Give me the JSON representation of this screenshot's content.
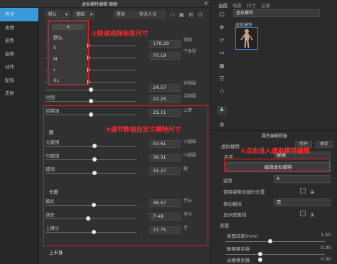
{
  "dialog": {
    "title": "虚拟模特编辑 娜娜",
    "close": "×"
  },
  "nav": {
    "items": [
      "尺寸",
      "表情",
      "姿势",
      "姿势",
      "动作",
      "配饰",
      "皮肤"
    ]
  },
  "toolbar": {
    "preset": "默认",
    "basic": "基础",
    "unit": "厘米",
    "search_placeholder": "你点人台"
  },
  "dropdown": {
    "add": "+",
    "items": [
      "默认",
      "S",
      "M",
      "L",
      "XL"
    ]
  },
  "rows": [
    {
      "label": "",
      "value": "178.29",
      "knob": 0.46
    },
    {
      "label": "",
      "value": "70.19",
      "knob": 0.46
    },
    {
      "label": "",
      "value": "",
      "knob": 0.46
    },
    {
      "label": "",
      "value": "",
      "knob": 0.46
    },
    {
      "label": "",
      "value": "24.57",
      "knob": 0.5
    },
    {
      "label": "时围",
      "value": "22.25",
      "knob": 0.5
    },
    {
      "label": "前臂围",
      "value": "21.11",
      "knob": 0.5
    },
    {
      "label": "大腿围",
      "value": "50.61",
      "knob": 0.54
    },
    {
      "label": "中腿围",
      "value": "36.31",
      "knob": 0.54
    },
    {
      "label": "膝围",
      "value": "31.27",
      "knob": 0.54
    },
    {
      "label": "胸长",
      "value": "38.57",
      "knob": 0.53
    },
    {
      "label": "颈长",
      "value": "7.48",
      "knob": 0.47
    },
    {
      "label": "上臂长",
      "value": "27.75",
      "knob": 0.53
    }
  ],
  "sections": {
    "leg": "腿",
    "length": "长度",
    "upper": "上半身"
  },
  "right_col": [
    "领部",
    "下身型",
    "手腕围",
    "手腕围",
    "上臂",
    "小腿围",
    "小腿围",
    "腿",
    "手长",
    "手长",
    "手"
  ],
  "annotations": {
    "a1": "①点击进入虚拟模特编辑",
    "a2": "②快速选择标准尺寸",
    "a3": "③调节数值自定义模特尺寸"
  },
  "right_top": {
    "tabs": [
      "当前",
      "场景",
      "尺寸",
      "记录"
    ],
    "search_value": "虚拟模特",
    "caption": "虚拟模特",
    "icons": [
      "person-icon",
      "move-icon",
      "rotate-icon",
      "arrow-icon",
      "grid-icon",
      "list-icon",
      "people-icon",
      "person-icon",
      "globe-icon"
    ]
  },
  "props": {
    "title": "属性编辑视窗",
    "open_label": "打开",
    "save_label": "保存",
    "section_label": "虚拟模特",
    "name_label": "名字",
    "name_value": "娜娜",
    "edit_button": "编辑虚拟模特",
    "pose_label": "姿势",
    "pose_value": "A",
    "use_pose_label": "使用姿势创建时位置",
    "use_pose_state": "关",
    "param_label": "参加模拟",
    "param_value": "是",
    "show_mesh_label": "显示图案线",
    "show_mesh_state": "关",
    "surface_label": "表面",
    "surface_thickness_label": "表面间距(mm)",
    "surface_thickness_value": "1.50",
    "friction_label": "静摩擦系数",
    "friction_value": "0.30",
    "dyn_friction_label": "动摩擦系数",
    "dyn_friction_value": "0.30",
    "surface_thickness_knob": 0.45,
    "friction_knob": 0.35,
    "dyn_friction_knob": 0.35
  }
}
